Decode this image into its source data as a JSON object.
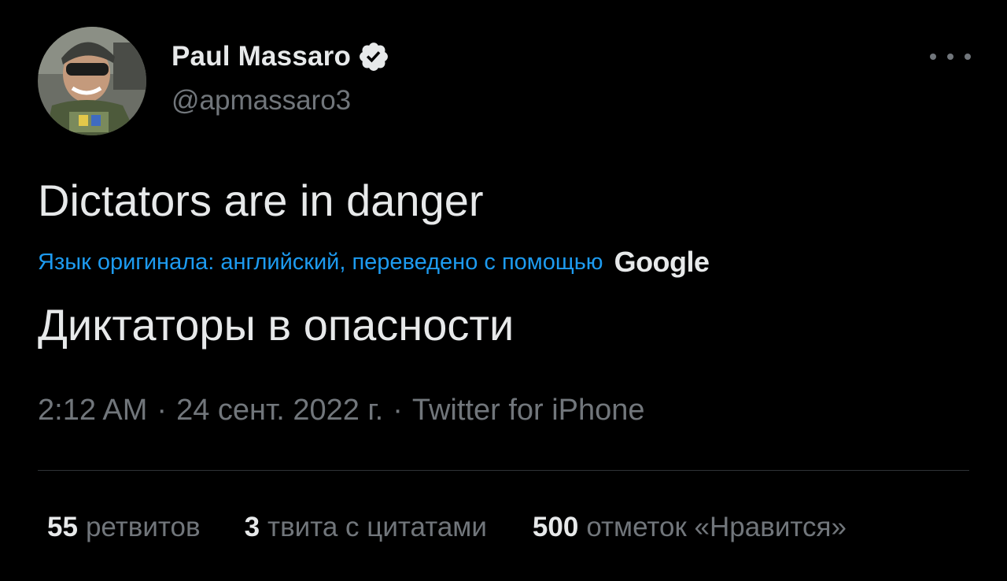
{
  "author": {
    "display_name": "Paul Massaro",
    "handle": "@apmassaro3",
    "verified_icon": "verified-badge-icon"
  },
  "menu": {
    "icon": "more-horizontal-icon"
  },
  "tweet": {
    "text": "Dictators are in danger",
    "translation_label": "Язык оригинала: английский, переведено с помощью",
    "translation_provider": "Google",
    "translated_text": "Диктаторы в опасности"
  },
  "meta": {
    "time": "2:12 AM",
    "separator": "·",
    "date": "24 сент. 2022 г.",
    "source": "Twitter for iPhone"
  },
  "stats": {
    "retweets_count": "55",
    "retweets_label": "ретвитов",
    "quotes_count": "3",
    "quotes_label": "твита с цитатами",
    "likes_count": "500",
    "likes_label": "отметок «Нравится»"
  },
  "colors": {
    "background": "#000000",
    "text_primary": "#e7e9ea",
    "text_secondary": "#71767b",
    "link_blue": "#1d9bf0",
    "divider": "#2f3336"
  }
}
